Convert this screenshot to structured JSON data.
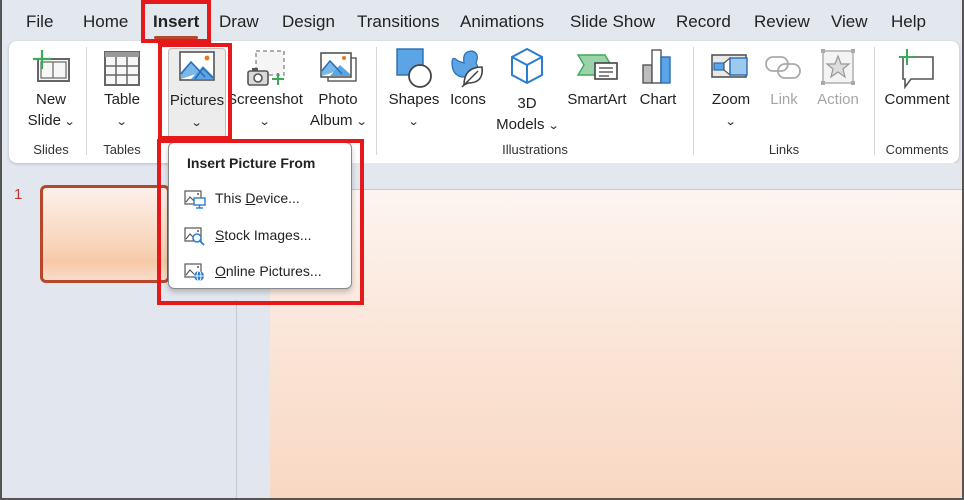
{
  "tabs": [
    {
      "label": "File",
      "active": false
    },
    {
      "label": "Home",
      "active": false
    },
    {
      "label": "Insert",
      "active": true
    },
    {
      "label": "Draw",
      "active": false
    },
    {
      "label": "Design",
      "active": false
    },
    {
      "label": "Transitions",
      "active": false
    },
    {
      "label": "Animations",
      "active": false
    },
    {
      "label": "Slide Show",
      "active": false
    },
    {
      "label": "Record",
      "active": false
    },
    {
      "label": "Review",
      "active": false
    },
    {
      "label": "View",
      "active": false
    },
    {
      "label": "Help",
      "active": false
    }
  ],
  "ribbon": {
    "groups": {
      "slides": "Slides",
      "tables": "Tables",
      "illustrations": "Illustrations",
      "links": "Links",
      "comments": "Comments"
    },
    "buttons": {
      "new_slide": {
        "line1": "New",
        "line2": "Slide",
        "icon": "new-slide-icon"
      },
      "table": {
        "line1": "Table",
        "icon": "table-icon"
      },
      "pictures": {
        "line1": "Pictures",
        "icon": "picture-icon"
      },
      "screenshot": {
        "line1": "Screenshot",
        "icon": "screenshot-icon"
      },
      "photo_album": {
        "line1": "Photo",
        "line2": "Album",
        "icon": "photo-album-icon"
      },
      "shapes": {
        "line1": "Shapes",
        "icon": "shapes-icon"
      },
      "icons": {
        "line1": "Icons",
        "icon": "icons-icon"
      },
      "models_3d": {
        "line1": "3D",
        "line2": "Models",
        "icon": "cube-icon"
      },
      "smartart": {
        "line1": "SmartArt",
        "icon": "smartart-icon"
      },
      "chart": {
        "line1": "Chart",
        "icon": "chart-icon"
      },
      "zoom": {
        "line1": "Zoom",
        "icon": "zoom-icon"
      },
      "link": {
        "line1": "Link",
        "icon": "link-icon",
        "disabled": true
      },
      "action": {
        "line1": "Action",
        "icon": "action-star-icon",
        "disabled": true
      },
      "comment": {
        "line1": "Comment",
        "icon": "comment-icon"
      }
    },
    "caret": "⌄"
  },
  "dropdown": {
    "title": "Insert Picture From",
    "items": [
      {
        "pre": "This ",
        "accel": "D",
        "post": "evice...",
        "icon": "device-picture-icon"
      },
      {
        "pre": "",
        "accel": "S",
        "post": "tock Images...",
        "icon": "stock-images-icon"
      },
      {
        "pre": "",
        "accel": "O",
        "post": "nline Pictures...",
        "icon": "online-pictures-icon"
      }
    ]
  },
  "slide_pane": {
    "slides": [
      {
        "number": "1",
        "selected": true
      }
    ]
  },
  "colors": {
    "accent": "#b7472a",
    "highlight": "#e5191c",
    "icon_blue": "#5ba4e5",
    "icon_green": "#3caa5a"
  }
}
